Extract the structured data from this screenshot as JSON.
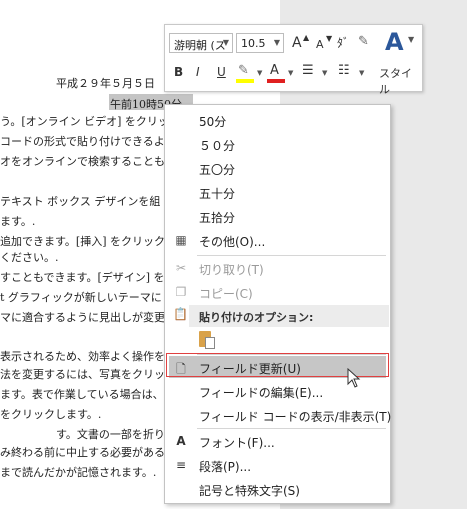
{
  "document": {
    "date_line": "平成２９年５月５日",
    "selected_time": "午前10時50分",
    "lines": [
      "う。[オンライン ビデオ] をクリッ",
      "コードの形式で貼り付けできるよう",
      "オをオンラインで検索することもで",
      "",
      "テキスト ボックス デザインを組",
      "ます。.",
      "追加できます。[挿入] をクリック",
      "ください。.",
      "すこともできます。[デザイン] を",
      "t グラフィックが新しいテーマに",
      "マに適合するように見出しが変更",
      "",
      "表示されるため、効率よく操作を",
      "法を変更するには、写真をクリッ",
      "ます。表で作業している場合は、",
      "をクリックします。.",
      "す。文書の一部を折りた",
      "み終わる前に中止する必要がある",
      "まで読んだかが記憶されます。."
    ]
  },
  "mini_toolbar": {
    "font_name": "游明朝 (ス",
    "font_size": "10.5",
    "grow_font": "A",
    "shrink_font": "A",
    "bold": "B",
    "italic": "I",
    "underline": "U",
    "styles_label": "スタイル"
  },
  "context_menu": {
    "field_values": [
      "50分",
      "５０分",
      "五〇分",
      "五十分",
      "五拾分"
    ],
    "other": "その他(O)...",
    "cut": "切り取り(T)",
    "copy": "コピー(C)",
    "paste_header": "貼り付けのオプション:",
    "update_field": "フィールド更新(U)",
    "edit_field": "フィールドの編集(E)...",
    "toggle_codes": "フィールド コードの表示/非表示(T)",
    "font": "フォント(F)...",
    "paragraph": "段落(P)...",
    "symbols": "記号と特殊文字(S)"
  },
  "colors": {
    "highlight_yellow": "#ffff00",
    "font_red": "#e02020",
    "accent_blue": "#2b579a",
    "hover_gray": "#c6c6c6",
    "focus_red": "#e04040"
  }
}
